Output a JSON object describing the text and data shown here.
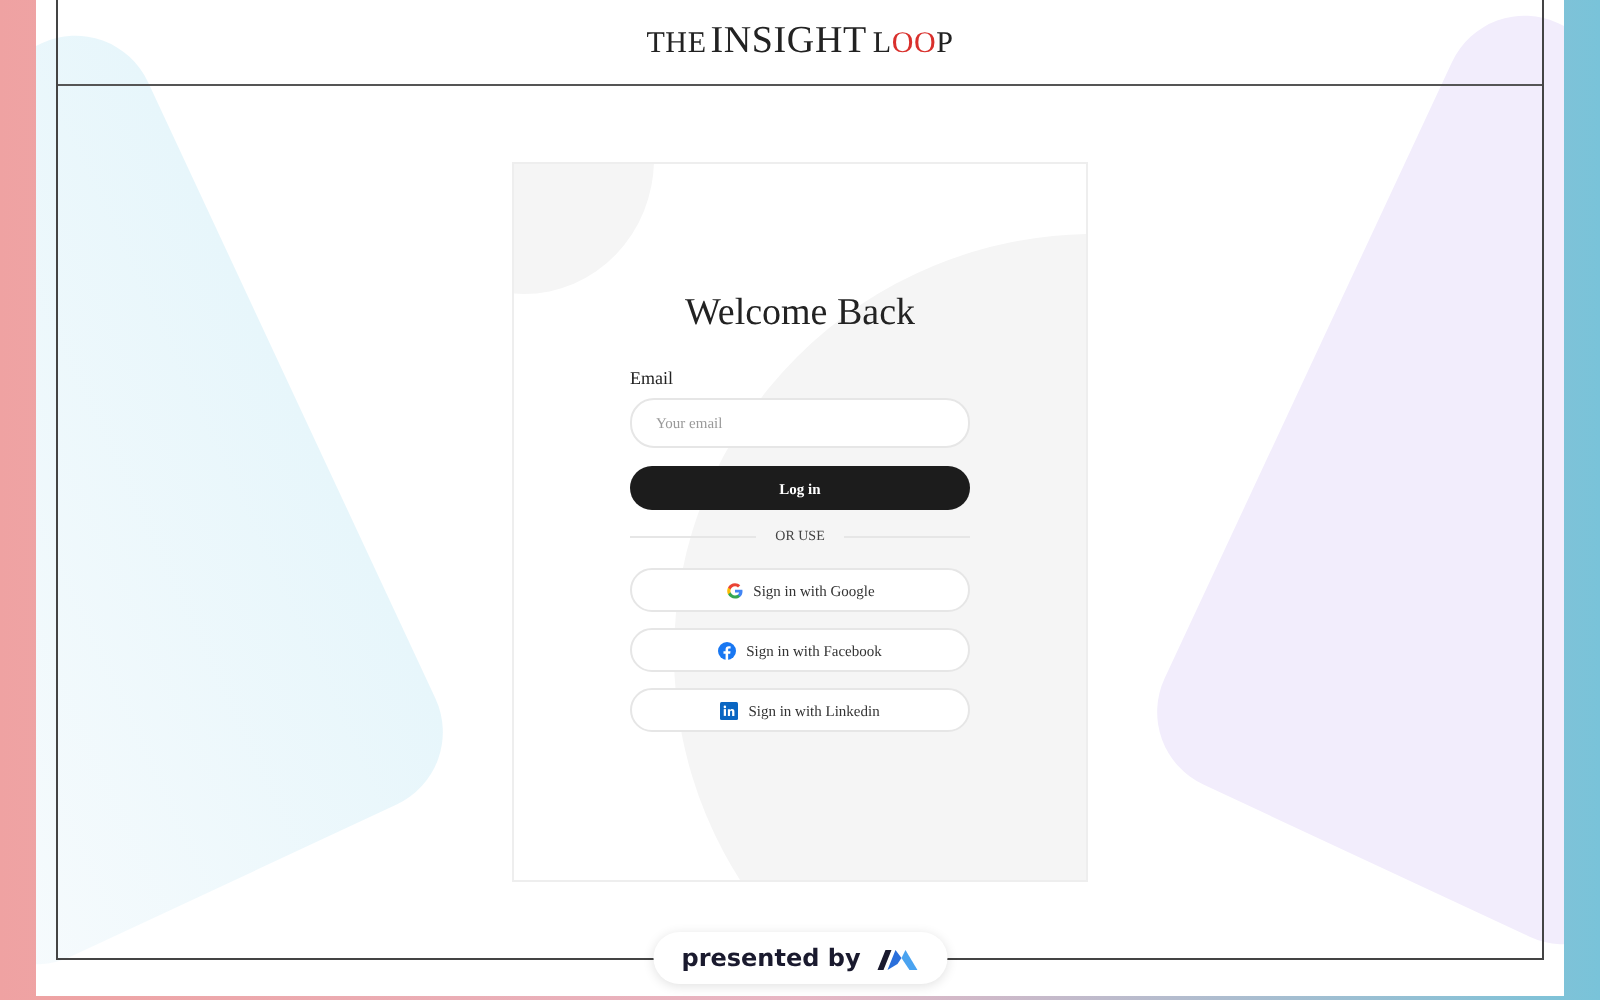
{
  "header": {
    "logo": {
      "prefix": "THE",
      "main": "INSIGHT",
      "suffix": "LOOP"
    }
  },
  "login": {
    "title": "Welcome Back",
    "email_label": "Email",
    "email_placeholder": "Your email",
    "submit": "Log in",
    "divider": "OR USE",
    "providers": [
      {
        "kind": "google",
        "label": "Sign in with Google"
      },
      {
        "kind": "facebook",
        "label": "Sign in with Facebook"
      },
      {
        "kind": "linkedin",
        "label": "Sign in with Linkedin"
      }
    ]
  },
  "footer": {
    "badge": "presented by"
  }
}
